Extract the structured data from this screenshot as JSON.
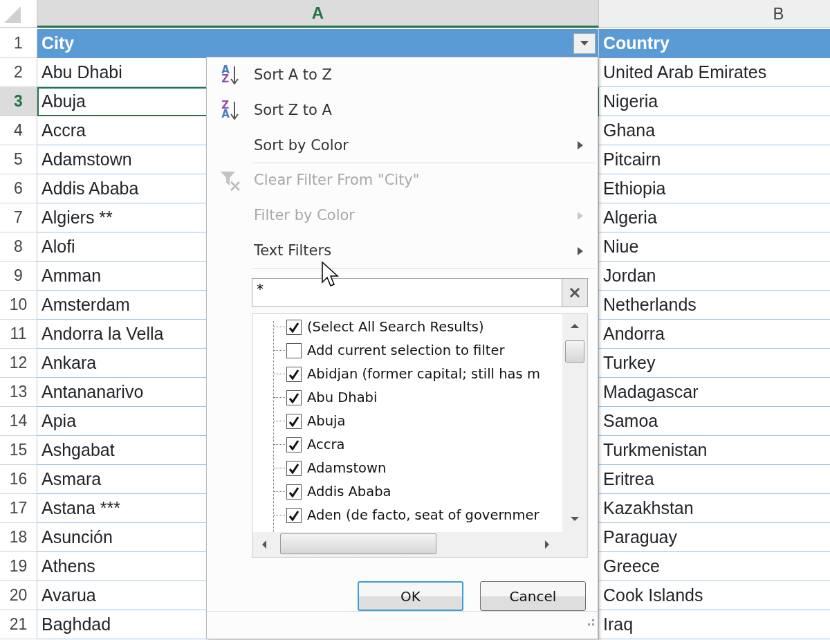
{
  "sheet": {
    "columns": [
      {
        "label": "A",
        "selected": true
      },
      {
        "label": "B",
        "selected": false
      }
    ],
    "rows": [
      {
        "number": "1",
        "kind": "header",
        "selected": false,
        "cells": [
          "City",
          "Country"
        ]
      },
      {
        "number": "2",
        "kind": "data",
        "selected": false,
        "cells": [
          "Abu Dhabi",
          "United Arab Emirates"
        ]
      },
      {
        "number": "3",
        "kind": "data",
        "selected": true,
        "cells": [
          "Abuja",
          "Nigeria"
        ]
      },
      {
        "number": "4",
        "kind": "data",
        "selected": false,
        "cells": [
          "Accra",
          "Ghana"
        ]
      },
      {
        "number": "5",
        "kind": "data",
        "selected": false,
        "cells": [
          "Adamstown",
          "Pitcairn"
        ]
      },
      {
        "number": "6",
        "kind": "data",
        "selected": false,
        "cells": [
          "Addis Ababa",
          "Ethiopia"
        ]
      },
      {
        "number": "7",
        "kind": "data",
        "selected": false,
        "cells": [
          "Algiers **",
          "Algeria"
        ]
      },
      {
        "number": "8",
        "kind": "data",
        "selected": false,
        "cells": [
          "Alofi",
          "Niue"
        ]
      },
      {
        "number": "9",
        "kind": "data",
        "selected": false,
        "cells": [
          "Amman",
          "Jordan"
        ]
      },
      {
        "number": "10",
        "kind": "data",
        "selected": false,
        "cells": [
          "Amsterdam",
          "Netherlands"
        ]
      },
      {
        "number": "11",
        "kind": "data",
        "selected": false,
        "cells": [
          "Andorra la Vella",
          "Andorra"
        ]
      },
      {
        "number": "12",
        "kind": "data",
        "selected": false,
        "cells": [
          "Ankara",
          "Turkey"
        ]
      },
      {
        "number": "13",
        "kind": "data",
        "selected": false,
        "cells": [
          "Antananarivo",
          "Madagascar"
        ]
      },
      {
        "number": "14",
        "kind": "data",
        "selected": false,
        "cells": [
          "Apia",
          "Samoa"
        ]
      },
      {
        "number": "15",
        "kind": "data",
        "selected": false,
        "cells": [
          "Ashgabat",
          "Turkmenistan"
        ]
      },
      {
        "number": "16",
        "kind": "data",
        "selected": false,
        "cells": [
          "Asmara",
          "Eritrea"
        ]
      },
      {
        "number": "17",
        "kind": "data",
        "selected": false,
        "cells": [
          "Astana ***",
          "Kazakhstan"
        ]
      },
      {
        "number": "18",
        "kind": "data",
        "selected": false,
        "cells": [
          "Asunción",
          "Paraguay"
        ]
      },
      {
        "number": "19",
        "kind": "data",
        "selected": false,
        "cells": [
          "Athens",
          "Greece"
        ]
      },
      {
        "number": "20",
        "kind": "data",
        "selected": false,
        "cells": [
          "Avarua",
          "Cook Islands"
        ]
      },
      {
        "number": "21",
        "kind": "data",
        "selected": false,
        "cells": [
          "Baghdad",
          "Iraq"
        ]
      }
    ]
  },
  "filter_menu": {
    "items": [
      {
        "label": "Sort A to Z",
        "kind": "sort_ascending",
        "icon_letters": [
          "A",
          "Z"
        ],
        "disabled": false,
        "submenu": false,
        "separator_after": false
      },
      {
        "label": "Sort Z to A",
        "kind": "sort_descending",
        "icon_letters": [
          "Z",
          "A"
        ],
        "disabled": false,
        "submenu": false,
        "separator_after": false
      },
      {
        "label": "Sort by Color",
        "kind": "plain",
        "disabled": false,
        "submenu": true,
        "separator_after": true
      },
      {
        "label": "Clear Filter From \"City\"",
        "kind": "clear_filter",
        "disabled": true,
        "submenu": false,
        "separator_after": false
      },
      {
        "label": "Filter by Color",
        "kind": "plain",
        "disabled": true,
        "submenu": true,
        "separator_after": false
      },
      {
        "label": "Text Filters",
        "kind": "plain",
        "disabled": false,
        "submenu": true,
        "separator_after": true
      }
    ],
    "search": {
      "value": "*"
    },
    "list": [
      {
        "label": "(Select All Search Results)",
        "checked": true
      },
      {
        "label": "Add current selection to filter",
        "checked": false
      },
      {
        "label": "Abidjan (former capital; still has m",
        "checked": true
      },
      {
        "label": "Abu Dhabi",
        "checked": true
      },
      {
        "label": "Abuja",
        "checked": true
      },
      {
        "label": "Accra",
        "checked": true
      },
      {
        "label": "Adamstown",
        "checked": true
      },
      {
        "label": "Addis Ababa",
        "checked": true
      },
      {
        "label": "Aden (de facto, seat of governmer",
        "checked": true
      }
    ],
    "buttons": [
      {
        "label": "OK",
        "default": true
      },
      {
        "label": "Cancel",
        "default": false
      }
    ]
  }
}
